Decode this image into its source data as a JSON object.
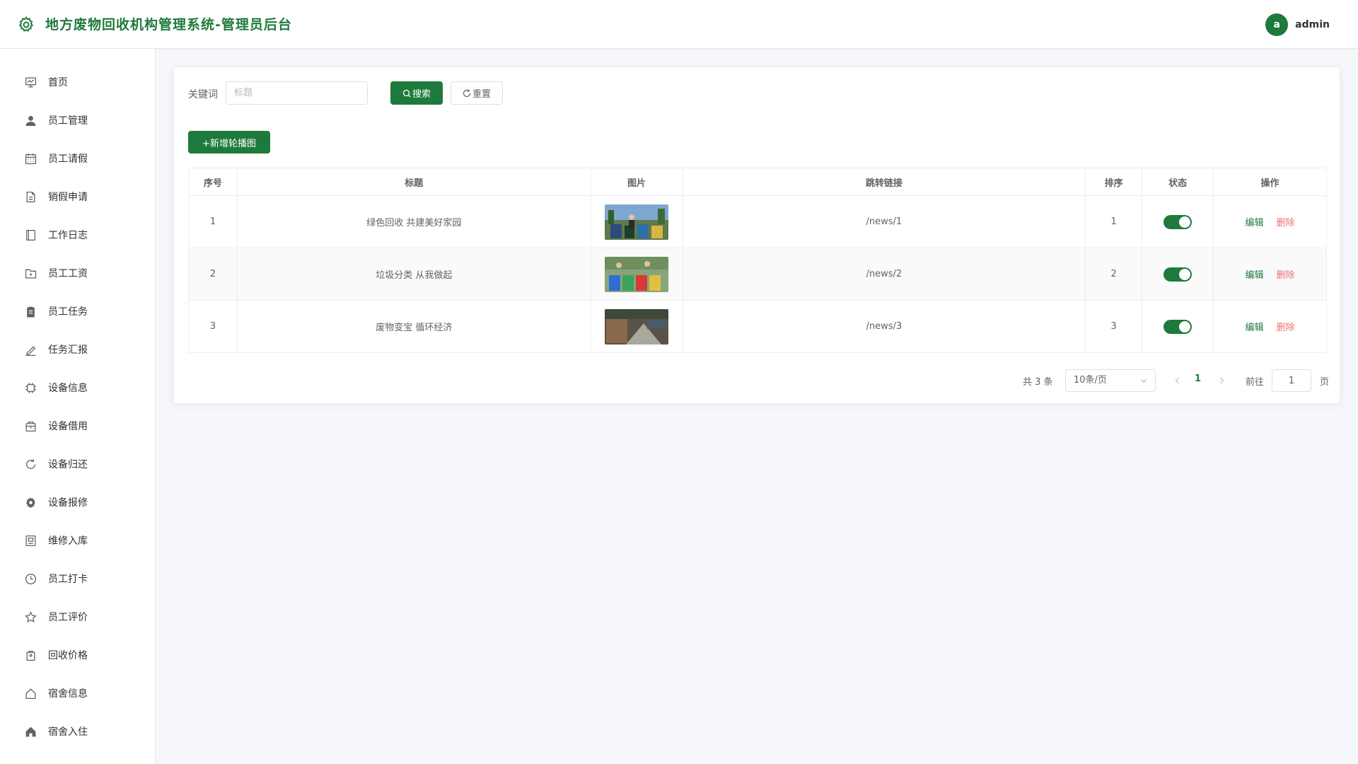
{
  "header": {
    "title": "地方废物回收机构管理系统-管理员后台",
    "avatar_letter": "a",
    "username": "admin"
  },
  "sidebar": {
    "items": [
      {
        "label": "首页",
        "icon": "monitor-icon"
      },
      {
        "label": "员工管理",
        "icon": "user-icon"
      },
      {
        "label": "员工请假",
        "icon": "calendar-icon"
      },
      {
        "label": "销假申请",
        "icon": "document-icon"
      },
      {
        "label": "工作日志",
        "icon": "notebook-icon"
      },
      {
        "label": "员工工资",
        "icon": "folder-icon"
      },
      {
        "label": "员工任务",
        "icon": "clipboard-icon"
      },
      {
        "label": "任务汇报",
        "icon": "edit-pen-icon"
      },
      {
        "label": "设备信息",
        "icon": "cpu-icon"
      },
      {
        "label": "设备借用",
        "icon": "box-icon"
      },
      {
        "label": "设备归还",
        "icon": "refresh-icon"
      },
      {
        "label": "设备报修",
        "icon": "gear-icon"
      },
      {
        "label": "维修入库",
        "icon": "warehouse-icon"
      },
      {
        "label": "员工打卡",
        "icon": "clock-icon"
      },
      {
        "label": "员工评价",
        "icon": "star-icon"
      },
      {
        "label": "回收价格",
        "icon": "price-tag-icon"
      },
      {
        "label": "宿舍信息",
        "icon": "house-outline-icon"
      },
      {
        "label": "宿舍入住",
        "icon": "house-filled-icon"
      }
    ]
  },
  "search": {
    "label": "关键词",
    "placeholder": "标题",
    "value": "",
    "search_button": "搜索",
    "reset_button": "重置"
  },
  "add_button": "+新增轮播图",
  "table": {
    "headers": [
      "序号",
      "标题",
      "图片",
      "跳转链接",
      "排序",
      "状态",
      "操作"
    ],
    "rows": [
      {
        "index": "1",
        "title": "绿色回收 共建美好家园",
        "link": "/news/1",
        "sort": "1",
        "enabled": true,
        "image": "recycling-workers-image"
      },
      {
        "index": "2",
        "title": "垃圾分类 从我做起",
        "link": "/news/2",
        "sort": "2",
        "enabled": true,
        "image": "sorting-bins-image"
      },
      {
        "index": "3",
        "title": "废物变宝 循环经济",
        "link": "/news/3",
        "sort": "3",
        "enabled": true,
        "image": "recycling-plant-image"
      }
    ],
    "edit_label": "编辑",
    "delete_label": "删除"
  },
  "pagination": {
    "total": "共 3 条",
    "page_size": "10条/页",
    "current_page": "1",
    "goto_label": "前往",
    "goto_value": "1",
    "page_unit": "页"
  },
  "colors": {
    "primary": "#1e7a3c",
    "danger": "#f56c6c",
    "background": "#f5f7fa"
  }
}
